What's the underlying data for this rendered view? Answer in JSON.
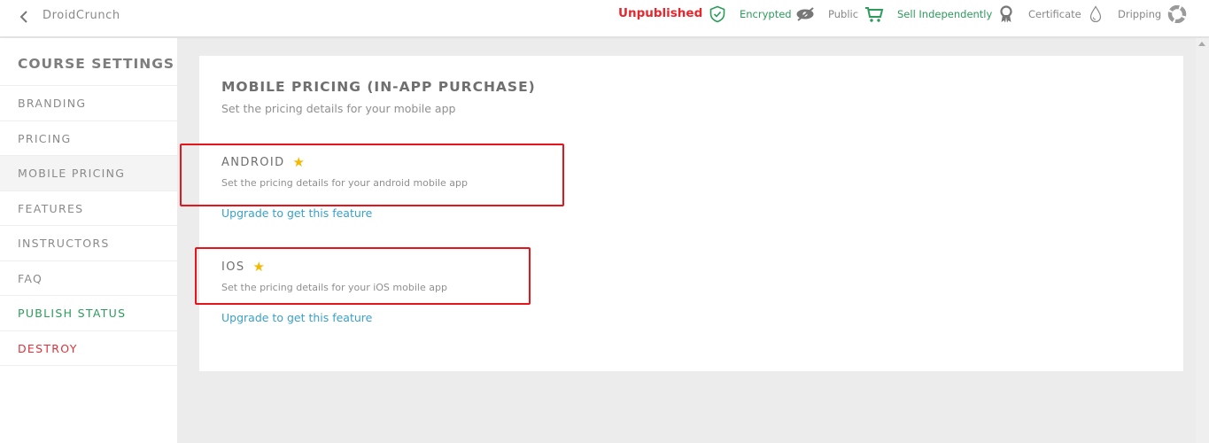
{
  "header": {
    "back_icon": "chevron-left-icon",
    "app_name": "DroidCrunch",
    "publish_state": "Unpublished",
    "statuses": [
      {
        "icon": "shield-check-icon",
        "label": "Encrypted",
        "color": "#2e9b5b"
      },
      {
        "icon": "eye-slash-icon",
        "label": "Public",
        "color": "#888888"
      },
      {
        "icon": "cart-icon",
        "label": "Sell Independently",
        "color": "#2e9b5b"
      },
      {
        "icon": "ribbon-award-icon",
        "label": "Certificate",
        "color": "#888888"
      },
      {
        "icon": "drop-icon",
        "label": "Dripping",
        "color": "#888888"
      },
      {
        "icon": "lifebuoy-icon",
        "label": "",
        "color": "#888888"
      }
    ]
  },
  "sidebar": {
    "title": "COURSE SETTINGS",
    "items": [
      {
        "label": "BRANDING"
      },
      {
        "label": "PRICING"
      },
      {
        "label": "MOBILE PRICING",
        "active": true
      },
      {
        "label": "FEATURES"
      },
      {
        "label": "INSTRUCTORS"
      },
      {
        "label": "FAQ"
      },
      {
        "label": "PUBLISH STATUS",
        "color": "#2e9b5b"
      },
      {
        "label": "DESTROY",
        "color": "#e0313a"
      }
    ]
  },
  "main": {
    "title": "MOBILE PRICING (IN-APP PURCHASE)",
    "subtitle": "Set the pricing details for your mobile app",
    "platforms": [
      {
        "name": "ANDROID",
        "premium_icon": "star-icon",
        "description": "Set the pricing details for your android mobile app",
        "link": "Upgrade to get this feature"
      },
      {
        "name": "IOS",
        "premium_icon": "star-icon",
        "description": "Set the pricing details for your iOS mobile app",
        "link": "Upgrade to get this feature"
      }
    ]
  },
  "colors": {
    "accent_green": "#2e9b5b",
    "danger_red": "#e0313a",
    "link_blue": "#3aa0c8",
    "star_gold": "#f5b800",
    "highlight_red": "#e8141c"
  }
}
